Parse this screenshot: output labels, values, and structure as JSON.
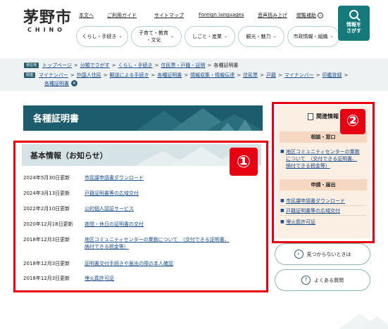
{
  "header": {
    "logo_main": "茅野市",
    "logo_sub": "CHINO",
    "util_links": [
      "本文へ",
      "ご利用ガイド",
      "サイトマップ",
      "Foreign languages",
      "音声読み上げ",
      "閲覧補助"
    ],
    "nav": [
      {
        "label": "くらし・手続き"
      },
      {
        "label": "子育て・教育・文化",
        "line1": "子育て・教育",
        "line2": "・文化"
      },
      {
        "label": "しごと・産業"
      },
      {
        "label": "観光・魅力"
      },
      {
        "label": "市政情報・組織"
      }
    ],
    "search": {
      "line1": "情報を",
      "line2": "さがす",
      "icon": "search-icon"
    }
  },
  "breadcrumbs": {
    "current_tag": "現在地",
    "current_path": [
      "トップページ",
      "分類でさがす",
      "くらし・手続き",
      "住民票・戸籍・証明",
      "各種証明書"
    ],
    "tags_tag": "関連",
    "tags_line1": [
      "マイナンバー",
      "外国人住民",
      "郵送による手続き",
      "各種証明書",
      "情報収集・情報伝達",
      "住民票",
      "戸籍",
      "マイナンバー",
      "印鑑登録"
    ],
    "tags_line2": [
      "各種証明書"
    ],
    "separator": ">",
    "slash": "/"
  },
  "page_title": "各種証明書",
  "main": {
    "section_title": "基本情報（お知らせ）",
    "badge": "①",
    "news": [
      {
        "date": "2024年5月30日更新",
        "title": "市民課申請書ダウンロード"
      },
      {
        "date": "2024年3月13日更新",
        "title": "戸籍証明書等の広域交付"
      },
      {
        "date": "2022年2月10日更新",
        "title": "公的個人認証サービス"
      },
      {
        "date": "2020年12月18日更新",
        "title": "夜間・休日の証明書の交付"
      },
      {
        "date": "2018年12月3日更新",
        "title_line1": "地区コミュニティセンターの業務について　（交付できる証明書、",
        "title_line2": "納付できる税金等）"
      },
      {
        "date": "2018年12月3日更新",
        "title": "証明書交付手続きや届出の際の本人確認"
      },
      {
        "date": "2018年12月3日更新",
        "title": "埋火葬許可証"
      }
    ]
  },
  "side": {
    "heading": "関連情報",
    "badge": "②",
    "categories": [
      {
        "title": "相談・窓口",
        "items": [
          {
            "line1": "地区コミュニティセンターの業務",
            "line2": "について　（交付できる証明書、",
            "line3": "納付できる税金等）"
          }
        ]
      },
      {
        "title": "申請・届出",
        "items": [
          {
            "text": "市民課申請書ダウンロード"
          },
          {
            "text": "戸籍証明書等の広域交付"
          },
          {
            "text": "埋火葬許可証"
          }
        ]
      }
    ]
  },
  "help": [
    {
      "label": "見つからないときは",
      "icon": "search-icon"
    },
    {
      "label": "よくある質問",
      "icon": "question-icon"
    }
  ],
  "colors": {
    "brand_teal": "#167a7a",
    "title_band": "#1c5c6c",
    "highlight_red": "#e60012",
    "link_blue": "#1a4d8c",
    "side_bg": "#fbeee2"
  }
}
